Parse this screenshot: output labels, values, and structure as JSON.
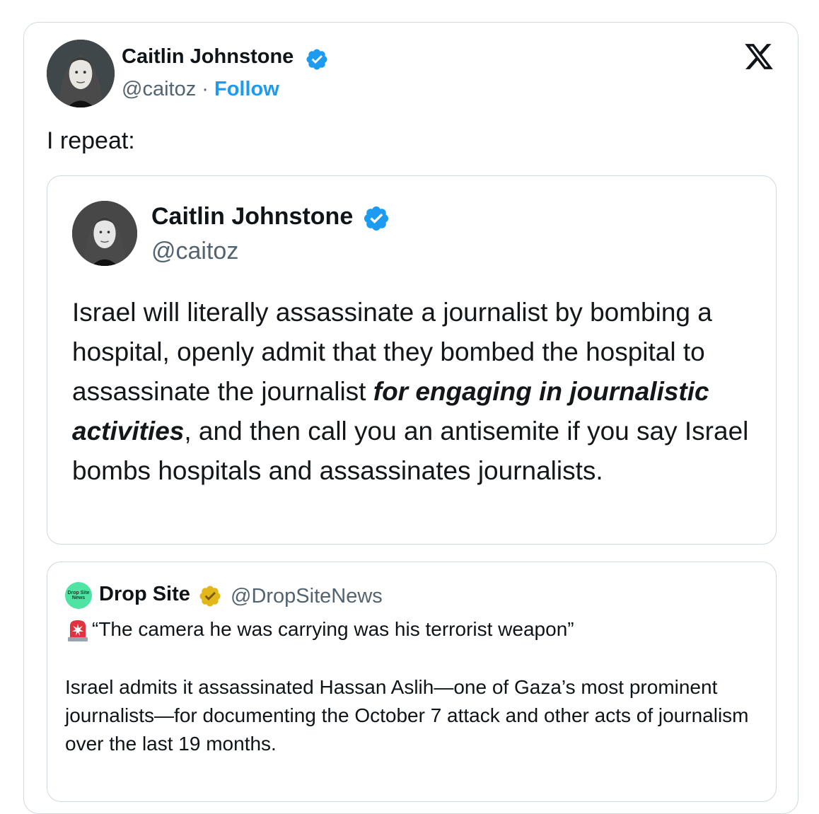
{
  "tweet": {
    "author": {
      "name": "Caitlin Johnstone",
      "handle": "@caitoz",
      "separator": "·",
      "follow_label": "Follow"
    },
    "text": "I repeat:",
    "logo_icon": "x-logo-icon"
  },
  "quote_image": {
    "author": {
      "name": "Caitlin Johnstone",
      "handle": "@caitoz"
    },
    "text_before": "Israel will literally assassinate a journalist by bombing a hospital, openly admit that they bombed the hospital to assassinate the journalist ",
    "text_emphasis": "for engaging in journalistic activities",
    "text_after": ", and then call you an antisemite if you say Israel bombs hospitals and assassinates journalists."
  },
  "quote_tweet": {
    "author": {
      "name": "Drop Site",
      "handle": "@DropSiteNews",
      "logo_text": "Drop Site News"
    },
    "headline": "“The camera he was carrying was his terrorist weapon”",
    "headline_icon": "siren-icon",
    "body": "Israel admits it assassinated Hassan Aslih—one of Gaza’s most prominent journalists—for documenting the October 7 attack and other acts of journalism over the last 19 months."
  },
  "colors": {
    "link_blue": "#1d9bf0",
    "verified_blue": "#1d9bf0",
    "verified_gold": "#e2b719",
    "muted_text": "#536471",
    "border": "#cfd9de",
    "drop_site_green": "#4fe3a4"
  }
}
